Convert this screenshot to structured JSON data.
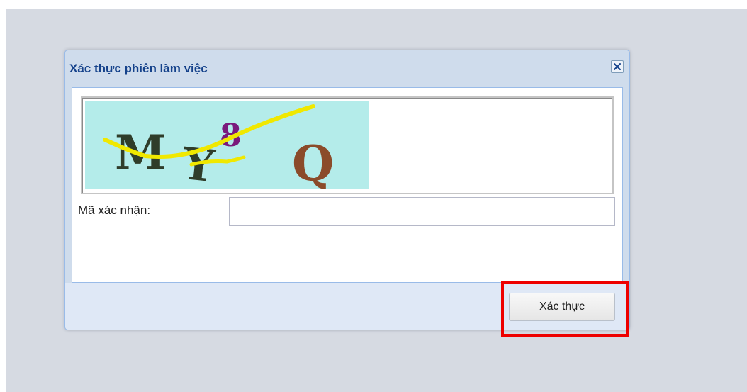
{
  "dialog": {
    "title": "Xác thực phiên làm việc",
    "close_icon": "close-icon"
  },
  "captcha": {
    "chars": [
      "M",
      "Y",
      "8",
      "Q"
    ],
    "background_color": "#b4ecea"
  },
  "form": {
    "label": "Mã xác nhận:",
    "value": "",
    "placeholder": ""
  },
  "footer": {
    "submit_label": "Xác thực"
  },
  "colors": {
    "title": "#15428b",
    "highlight": "#ee0000"
  }
}
